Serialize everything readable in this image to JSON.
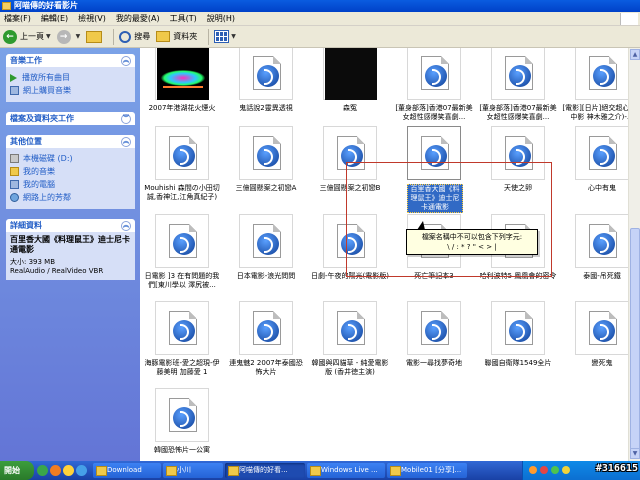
{
  "window": {
    "title": "阿喵傳的好看影片"
  },
  "menu": [
    "檔案(F)",
    "編輯(E)",
    "檢視(V)",
    "我的最愛(A)",
    "工具(T)",
    "說明(H)"
  ],
  "toolbar": {
    "back": "上一頁",
    "search": "搜尋",
    "folders": "資料夾"
  },
  "left": {
    "music_tasks": {
      "title": "音樂工作",
      "items": [
        "播放所有曲目",
        "網上購買音樂"
      ]
    },
    "file_tasks": {
      "title": "檔案及資料夾工作"
    },
    "other_places": {
      "title": "其他位置",
      "items": [
        "本機磁碟 (D:)",
        "我的音樂",
        "我的電腦",
        "網路上的芳鄰"
      ]
    },
    "details": {
      "title": "詳細資料",
      "name": "百里香大國《料理鼠王》迪士尼卡通電影",
      "size": "大小: 393 MB",
      "type": "RealAudio / RealVideo VBR"
    }
  },
  "files": [
    {
      "name": "2007年港湖花火煙火",
      "thumb": "fireworks"
    },
    {
      "name": "鬼話說2靈異透視",
      "thumb": "real"
    },
    {
      "name": "森冤",
      "thumb": "black"
    },
    {
      "name": "[董身部落]香港07最新美女超性感爆笑喜劇...",
      "thumb": "real"
    },
    {
      "name": "[董身部落]香港07最新美女超性感爆笑喜劇...",
      "thumb": "real"
    },
    {
      "name": "[電影][日片]絕交超心-(上中影 神木雅之介)-...",
      "thumb": "real"
    },
    {
      "name": "Mouhishi 森間の小田切誠,香神江,江角真紀子)",
      "thumb": "real"
    },
    {
      "name": "三億圓懸案之初戀A",
      "thumb": "real"
    },
    {
      "name": "三億圓懸案之初戀B",
      "thumb": "real"
    },
    {
      "name": "百里香大國《料理鼠王》迪士尼卡通電影",
      "thumb": "real",
      "selected": true
    },
    {
      "name": "天使之卵",
      "thumb": "real"
    },
    {
      "name": "心中有鬼",
      "thumb": "real"
    },
    {
      "name": "日電影 ]3 在有問題的我們[東川學以 澤尻被...",
      "thumb": "real"
    },
    {
      "name": "日本電影-浪光問問",
      "thumb": "real"
    },
    {
      "name": "日劇-午夜的陽光(電影版)",
      "thumb": "real"
    },
    {
      "name": "死亡筆記本3",
      "thumb": "real"
    },
    {
      "name": "哈利波特5 鳳凰會的密令",
      "thumb": "real"
    },
    {
      "name": "泰國-吊死鐵",
      "thumb": "real"
    },
    {
      "name": "海豚電影班-愛之超現-伊藤美明 加藤愛 1",
      "thumb": "real"
    },
    {
      "name": "連鬼魅2 2007年泰國恐怖大片",
      "thumb": "real"
    },
    {
      "name": "韓國與四貓草 - 純愛電影版 (香井徳主演)",
      "thumb": "real"
    },
    {
      "name": "電影一尋找夢奇地",
      "thumb": "real"
    },
    {
      "name": "聯國自衛隊1549全片",
      "thumb": "real"
    },
    {
      "name": "變死鬼",
      "thumb": "real"
    },
    {
      "name": "韓國恐怖片一公寓",
      "thumb": "real"
    }
  ],
  "tooltip": {
    "line1": "檔案名稱中不可以包含下列字元:",
    "line2": "\\ / : * ? \" < > |"
  },
  "taskbar": {
    "start": "開始",
    "buttons": [
      "Download",
      "小川",
      "阿喵傳的好看...",
      "Windows Live ...",
      "Mobile01 [分享]..."
    ],
    "watermark": "#316615"
  }
}
